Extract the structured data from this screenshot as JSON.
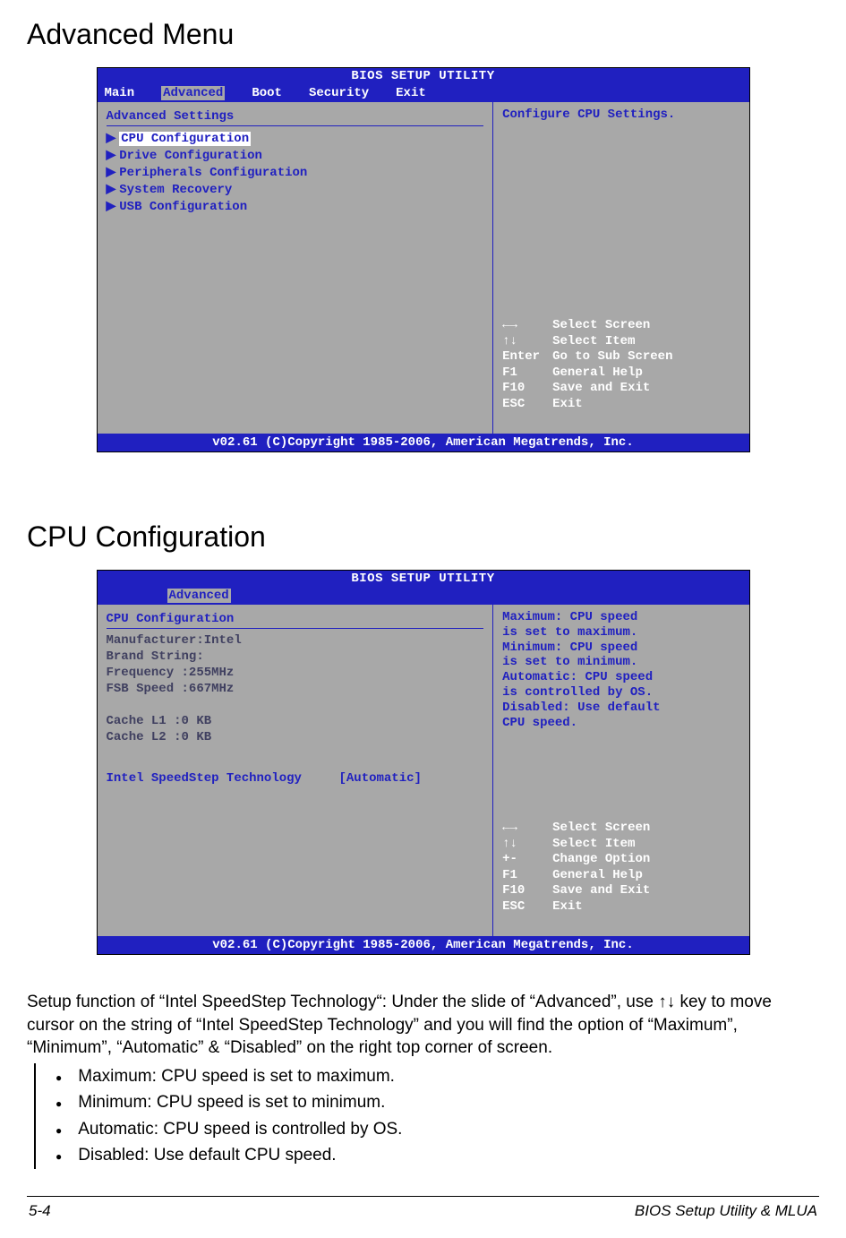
{
  "headings": {
    "advanced_menu": "Advanced Menu",
    "cpu_config": "CPU Configuration"
  },
  "bios1": {
    "title": "BIOS SETUP UTILITY",
    "tabs": [
      "Main",
      "Advanced",
      "Boot",
      "Security",
      "Exit"
    ],
    "active_tab": "Advanced",
    "panel_title": "Advanced Settings",
    "items": [
      "CPU Configuration",
      "Drive Configuration",
      "Peripherals Configuration",
      "System Recovery",
      "USB Configuration"
    ],
    "selected_idx": 0,
    "help": "Configure CPU Settings.",
    "nav": [
      {
        "k": "←→",
        "v": "Select Screen"
      },
      {
        "k": "↑↓",
        "v": "Select Item"
      },
      {
        "k": "Enter",
        "v": "Go to Sub Screen"
      },
      {
        "k": "F1",
        "v": "General Help"
      },
      {
        "k": "F10",
        "v": "Save and Exit"
      },
      {
        "k": "ESC",
        "v": "Exit"
      }
    ],
    "footer": "v02.61 (C)Copyright 1985-2006, American Megatrends, Inc."
  },
  "bios2": {
    "title": "BIOS SETUP UTILITY",
    "active_tab": "Advanced",
    "panel_title": "CPU Configuration",
    "info": [
      "Manufacturer:Intel",
      "Brand String:",
      "Frequency   :255MHz",
      "FSB Speed   :667MHz",
      "",
      "Cache L1    :0 KB",
      "Cache L2    :0 KB"
    ],
    "setting_label": "Intel SpeedStep Technology",
    "setting_value": "[Automatic]",
    "help_lines": [
      "Maximum: CPU speed",
      "is set to maximum.",
      "Minimum: CPU speed",
      "is set to minimum.",
      "Automatic: CPU speed",
      "is controlled by OS.",
      "Disabled: Use default",
      "CPU speed."
    ],
    "nav": [
      {
        "k": "←→",
        "v": "Select Screen"
      },
      {
        "k": "↑↓",
        "v": "Select Item"
      },
      {
        "k": "+-",
        "v": "Change Option"
      },
      {
        "k": "F1",
        "v": "General Help"
      },
      {
        "k": "F10",
        "v": "Save and Exit"
      },
      {
        "k": "ESC",
        "v": "Exit"
      }
    ],
    "footer": "v02.61 (C)Copyright 1985-2006, American Megatrends, Inc."
  },
  "paragraph": "Setup function of “Intel SpeedStep Technology“: Under the slide of “Advanced”, use ↑↓ key to move cursor on the string of “Intel SpeedStep Technology” and you will find the option of “Maximum”, “Minimum”, “Automatic” & “Disabled” on the right top corner of screen.",
  "bullets": [
    "Maximum: CPU speed is set to maximum.",
    "Minimum: CPU speed is set to minimum.",
    "Automatic: CPU speed is controlled by OS.",
    "Disabled: Use default CPU speed."
  ],
  "footer": {
    "left": "5-4",
    "right": "BIOS Setup Utility & MLUA"
  }
}
